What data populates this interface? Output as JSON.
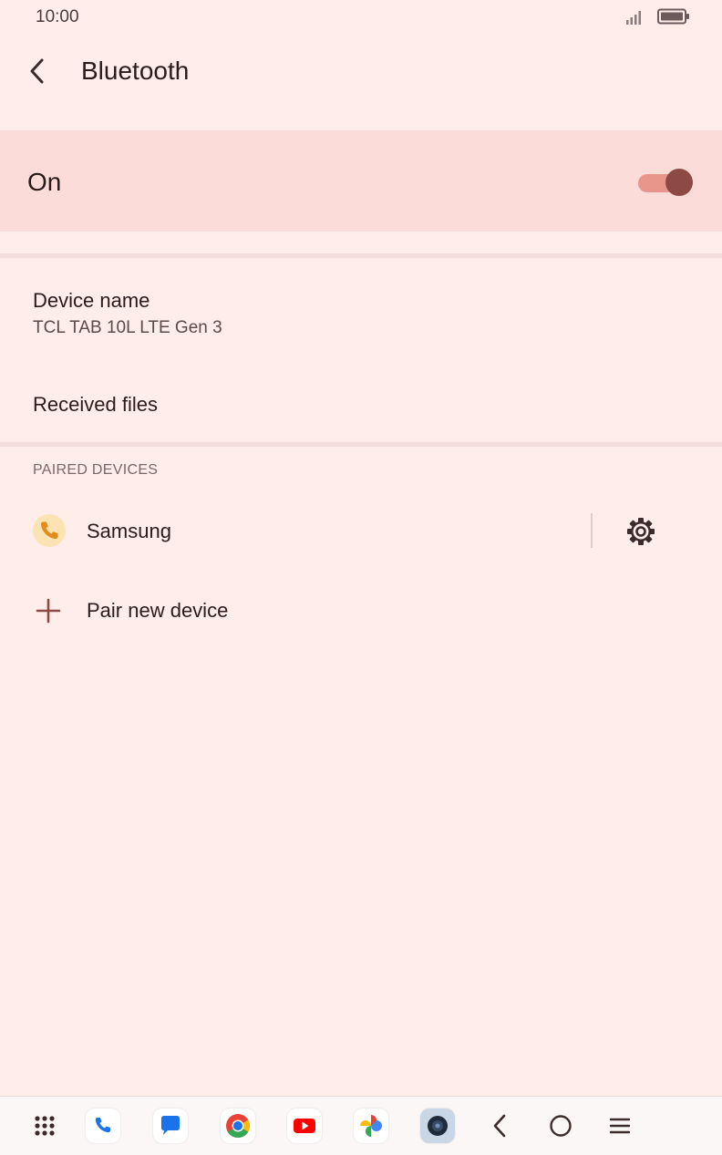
{
  "status_bar": {
    "time": "10:00",
    "signal_icon": "signal-icon",
    "battery_icon": "battery-icon"
  },
  "app_bar": {
    "title": "Bluetooth",
    "back_icon": "back-arrow-icon"
  },
  "main_switch": {
    "label": "On",
    "checked": true
  },
  "device_name": {
    "title": "Device name",
    "value": "TCL TAB 10L LTE Gen 3"
  },
  "received_files": {
    "title": "Received files"
  },
  "paired_devices": {
    "header": "PAIRED DEVICES",
    "items": [
      {
        "name": "Samsung",
        "icon": "phone-icon",
        "settings_icon": "gear-icon"
      }
    ]
  },
  "pair_new": {
    "label": "Pair new device",
    "icon": "plus-icon"
  },
  "nav_bar": {
    "items": [
      "app-drawer-icon",
      "phone-app-icon",
      "messages-app-icon",
      "chrome-app-icon",
      "youtube-app-icon",
      "photos-app-icon",
      "camera-app-icon",
      "nav-back-icon",
      "nav-home-icon",
      "nav-recents-icon"
    ]
  },
  "colors": {
    "background": "#ffedea",
    "switch_bar": "#fcdcd8",
    "toggle_track": "#e8958b",
    "toggle_thumb": "#8d4a44",
    "accent": "#8d4a44"
  }
}
